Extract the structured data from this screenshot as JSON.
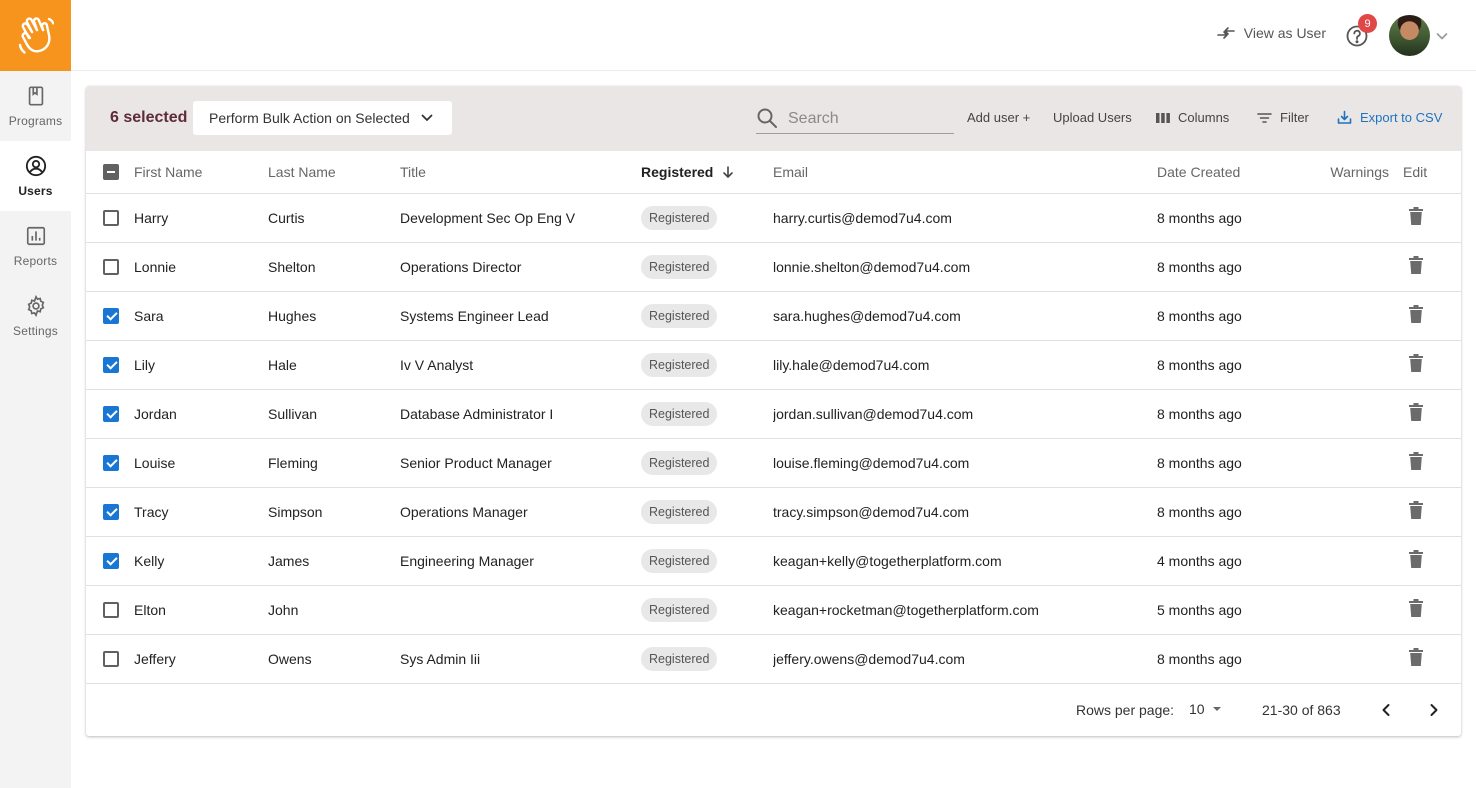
{
  "sidebar": {
    "items": [
      {
        "label": "Programs",
        "icon": "book-icon",
        "active": false
      },
      {
        "label": "Users",
        "icon": "user-circle-icon",
        "active": true
      },
      {
        "label": "Reports",
        "icon": "bar-chart-icon",
        "active": false
      },
      {
        "label": "Settings",
        "icon": "gear-icon",
        "active": false
      }
    ]
  },
  "topbar": {
    "view_as_user": "View as User",
    "notification_count": "9"
  },
  "toolbar": {
    "selected_count": "6 selected",
    "bulk_action": "Perform Bulk Action on Selected",
    "search_placeholder": "Search",
    "add_user": "Add user +",
    "upload_users": "Upload Users",
    "columns": "Columns",
    "filter": "Filter",
    "export_csv": "Export to CSV"
  },
  "table": {
    "headers": {
      "first_name": "First Name",
      "last_name": "Last Name",
      "title": "Title",
      "registered": "Registered",
      "email": "Email",
      "date_created": "Date Created",
      "warnings": "Warnings",
      "edit": "Edit"
    },
    "rows": [
      {
        "checked": false,
        "first": "Harry",
        "last": "Curtis",
        "title": "Development Sec Op Eng V",
        "status": "Registered",
        "email": "harry.curtis@demod7u4.com",
        "created": "8 months ago"
      },
      {
        "checked": false,
        "first": "Lonnie",
        "last": "Shelton",
        "title": "Operations Director",
        "status": "Registered",
        "email": "lonnie.shelton@demod7u4.com",
        "created": "8 months ago"
      },
      {
        "checked": true,
        "first": "Sara",
        "last": "Hughes",
        "title": "Systems Engineer Lead",
        "status": "Registered",
        "email": "sara.hughes@demod7u4.com",
        "created": "8 months ago"
      },
      {
        "checked": true,
        "first": "Lily",
        "last": "Hale",
        "title": "Iv V Analyst",
        "status": "Registered",
        "email": "lily.hale@demod7u4.com",
        "created": "8 months ago"
      },
      {
        "checked": true,
        "first": "Jordan",
        "last": "Sullivan",
        "title": "Database Administrator I",
        "status": "Registered",
        "email": "jordan.sullivan@demod7u4.com",
        "created": "8 months ago"
      },
      {
        "checked": true,
        "first": "Louise",
        "last": "Fleming",
        "title": "Senior Product Manager",
        "status": "Registered",
        "email": "louise.fleming@demod7u4.com",
        "created": "8 months ago"
      },
      {
        "checked": true,
        "first": "Tracy",
        "last": "Simpson",
        "title": "Operations Manager",
        "status": "Registered",
        "email": "tracy.simpson@demod7u4.com",
        "created": "8 months ago"
      },
      {
        "checked": true,
        "first": "Kelly",
        "last": "James",
        "title": "Engineering Manager",
        "status": "Registered",
        "email": "keagan+kelly@togetherplatform.com",
        "created": "4 months ago"
      },
      {
        "checked": false,
        "first": "Elton",
        "last": "John",
        "title": "",
        "status": "Registered",
        "email": "keagan+rocketman@togetherplatform.com",
        "created": "5 months ago"
      },
      {
        "checked": false,
        "first": "Jeffery",
        "last": "Owens",
        "title": "Sys Admin Iii",
        "status": "Registered",
        "email": "jeffery.owens@demod7u4.com",
        "created": "8 months ago"
      }
    ]
  },
  "pagination": {
    "rows_per_page_label": "Rows per page:",
    "rows_per_page": "10",
    "range": "21-30 of 863"
  },
  "colors": {
    "brand": "#f7941d",
    "toolbar_bg": "#ebe6e6",
    "selected_text": "#5d2a3e",
    "link_blue": "#1e73be",
    "checkbox_blue": "#1976d2",
    "badge_red": "#e04848"
  }
}
